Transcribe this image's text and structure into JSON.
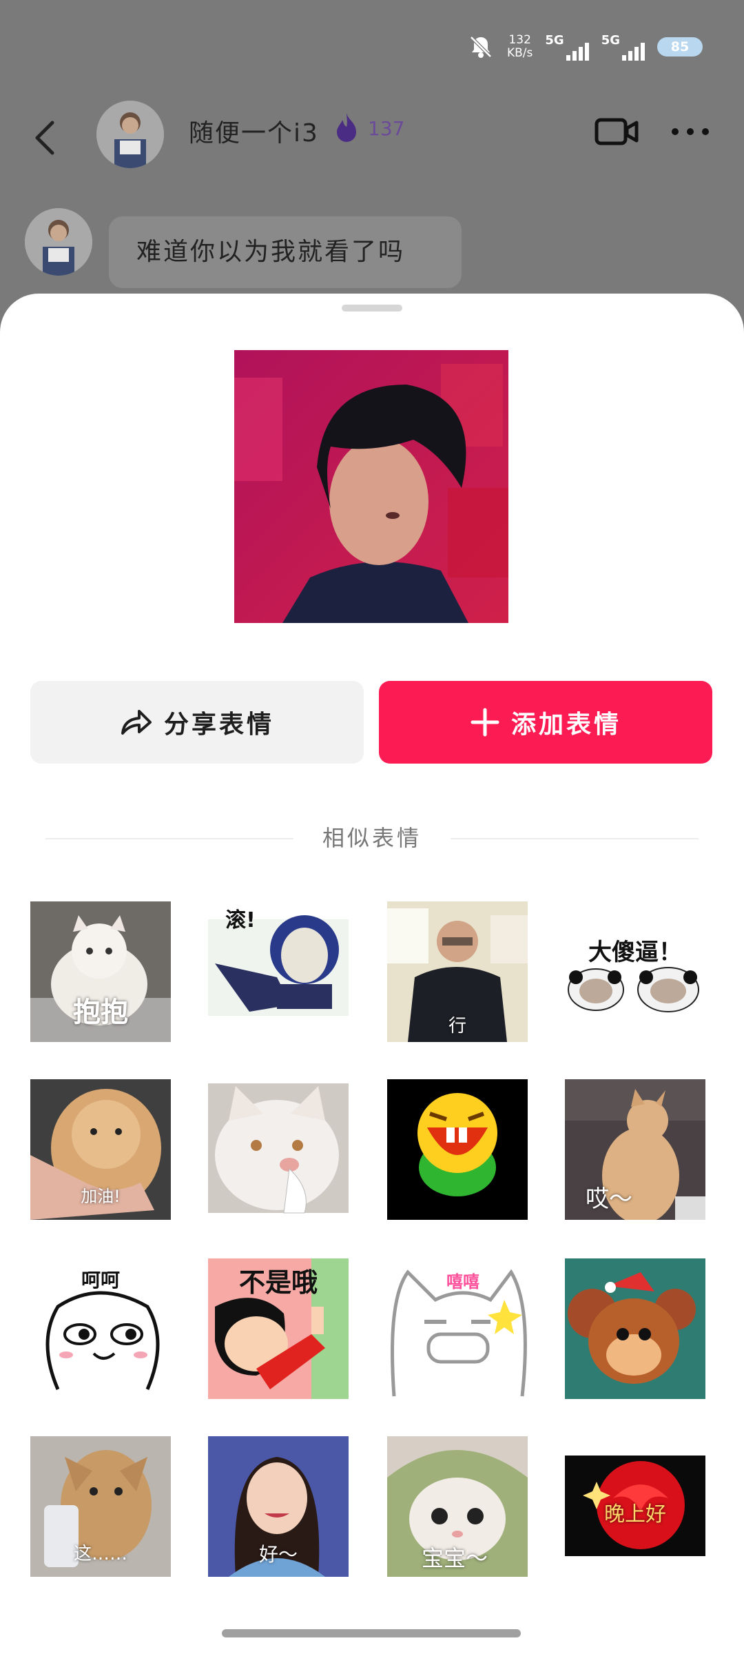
{
  "status_bar": {
    "net_speed_value": "132",
    "net_speed_unit": "KB/s",
    "network_1": "5G",
    "network_2": "5G",
    "battery": "85"
  },
  "header": {
    "contact_name": "随便一个i3",
    "streak_count": "137"
  },
  "chat": {
    "last_message": "难道你以为我就看了吗"
  },
  "actions": {
    "share_label": "分享表情",
    "add_label": "添加表情",
    "add_color": "#fc1b53"
  },
  "similar": {
    "title": "相似表情",
    "stickers": [
      {
        "caption": "抱抱",
        "icon": "cat-hug-sticker"
      },
      {
        "caption": "滚!",
        "icon": "cartoon-man-pointing-sticker"
      },
      {
        "caption": "行",
        "icon": "man-with-glasses-sticker"
      },
      {
        "caption": "大傻逼！",
        "icon": "panda-meme-sticker"
      },
      {
        "caption": "加油!",
        "icon": "cat-held-sticker"
      },
      {
        "caption": "",
        "icon": "white-cat-sticker"
      },
      {
        "caption": "",
        "icon": "laughing-emoji-sticker"
      },
      {
        "caption": "哎～",
        "icon": "orange-cat-sticker"
      },
      {
        "caption": "呵呵",
        "icon": "smirk-face-sticker"
      },
      {
        "caption": "不是哦",
        "icon": "crayon-shin-sticker"
      },
      {
        "caption": "嘻嘻",
        "icon": "grin-cat-drawing-sticker"
      },
      {
        "caption": "",
        "icon": "jerry-mouse-sticker"
      },
      {
        "caption": "这……",
        "icon": "dog-phone-sticker"
      },
      {
        "caption": "好～",
        "icon": "girl-smile-sticker"
      },
      {
        "caption": "宝宝～",
        "icon": "cat-blanket-sticker"
      },
      {
        "caption": "晚上好",
        "icon": "red-rose-sticker"
      }
    ]
  }
}
